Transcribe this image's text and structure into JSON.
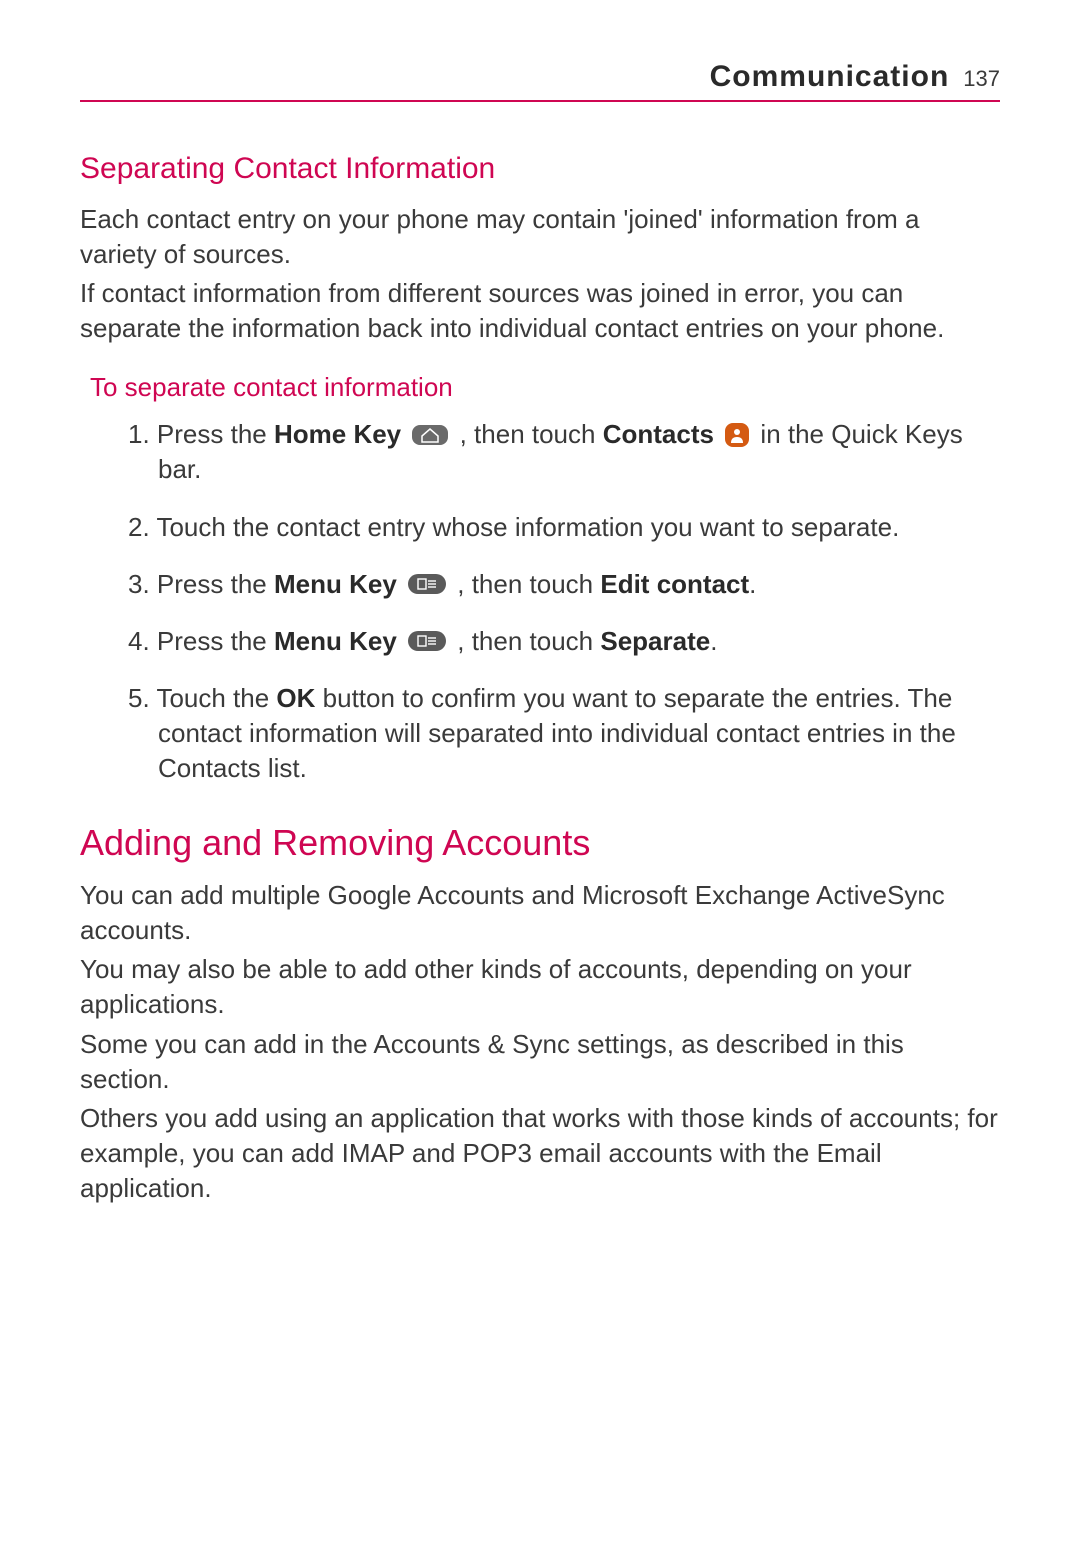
{
  "header": {
    "chapter": "Communication",
    "page_number": "137"
  },
  "section1": {
    "title": "Separating Contact Information",
    "para1": "Each contact entry on your phone may contain 'joined' information from a variety of sources.",
    "para2": "If contact information from different sources was joined in error, you can separate the information back into individual contact entries on your phone.",
    "sub_title": "To separate contact information",
    "steps": {
      "s1_num": "1. ",
      "s1_a": "Press the ",
      "s1_b": "Home Key",
      "s1_c": " , then touch ",
      "s1_d": "Contacts",
      "s1_e": " in the Quick Keys bar.",
      "s2_num": "2. ",
      "s2": "Touch the contact entry whose information you want to separate.",
      "s3_num": "3. ",
      "s3_a": "Press the ",
      "s3_b": "Menu Key",
      "s3_c": " , then touch ",
      "s3_d": "Edit contact",
      "s3_e": ".",
      "s4_num": "4. ",
      "s4_a": "Press the ",
      "s4_b": "Menu Key",
      "s4_c": " , then touch ",
      "s4_d": "Separate",
      "s4_e": ".",
      "s5_num": "5. ",
      "s5_a": "Touch the ",
      "s5_b": "OK",
      "s5_c": " button to confirm you want to separate the entries. The contact information will separated into individual contact entries in the Contacts list."
    }
  },
  "section2": {
    "title": "Adding and Removing Accounts",
    "para1": "You can add multiple Google Accounts and Microsoft Exchange ActiveSync accounts.",
    "para2": "You may also be able to add other kinds of accounts, depending on your applications.",
    "para3": "Some you can add in the Accounts & Sync settings, as described in this section.",
    "para4": "Others you add using an application that works with those kinds of accounts; for example, you can add IMAP and POP3 email accounts with the Email application."
  }
}
